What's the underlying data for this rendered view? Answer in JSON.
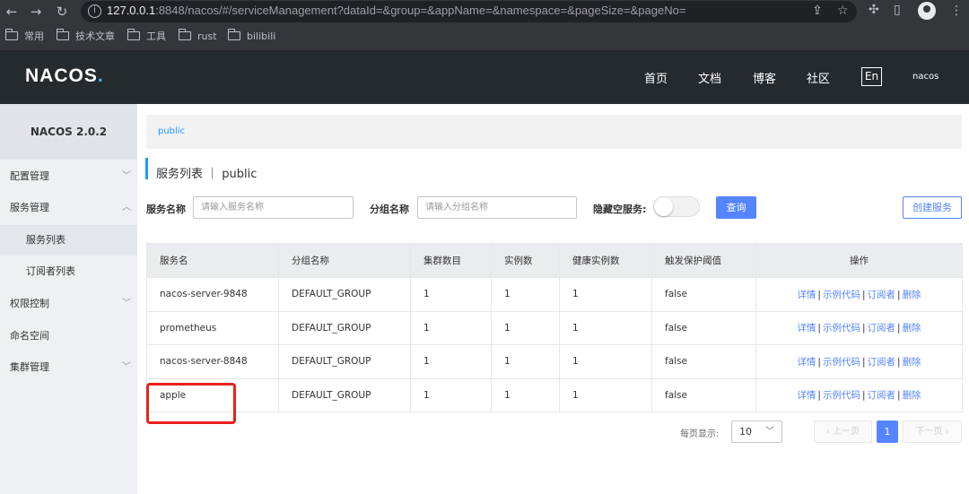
{
  "browser": {
    "url_host": "127.0.0.1",
    "url_rest": ":8848/nacos/#/serviceManagement?dataId=&group=&appName=&namespace=&pageSize=&pageNo=",
    "bookmarks": [
      "常用",
      "技术文章",
      "工具",
      "rust",
      "bilibili"
    ]
  },
  "header": {
    "logo_text": "NACOS",
    "logo_dot": ".",
    "nav": [
      "首页",
      "文档",
      "博客",
      "社区"
    ],
    "lang": "En",
    "user": "nacos"
  },
  "sidebar": {
    "title": "NACOS 2.0.2",
    "items": [
      {
        "label": "配置管理"
      },
      {
        "label": "服务管理"
      },
      {
        "label": "服务列表"
      },
      {
        "label": "订阅者列表"
      },
      {
        "label": "权限控制"
      },
      {
        "label": "命名空间"
      },
      {
        "label": "集群管理"
      }
    ]
  },
  "main": {
    "breadcrumb": "public",
    "title": "服务列表 ｜ public",
    "filters": {
      "service_label": "服务名称",
      "service_placeholder": "请输入服务名称",
      "group_label": "分组名称",
      "group_placeholder": "请输入分组名称",
      "hide_empty_label": "隐藏空服务:",
      "search_button": "查询",
      "create_button": "创建服务"
    },
    "table": {
      "columns": [
        "服务名",
        "分组名称",
        "集群数目",
        "实例数",
        "健康实例数",
        "触发保护阈值",
        "操作"
      ],
      "rows": [
        {
          "name": "nacos-server-9848",
          "group": "DEFAULT_GROUP",
          "clusters": "1",
          "instances": "1",
          "healthy": "1",
          "threshold": "false"
        },
        {
          "name": "prometheus",
          "group": "DEFAULT_GROUP",
          "clusters": "1",
          "instances": "1",
          "healthy": "1",
          "threshold": "false"
        },
        {
          "name": "nacos-server-8848",
          "group": "DEFAULT_GROUP",
          "clusters": "1",
          "instances": "1",
          "healthy": "1",
          "threshold": "false"
        },
        {
          "name": "apple",
          "group": "DEFAULT_GROUP",
          "clusters": "1",
          "instances": "1",
          "healthy": "1",
          "threshold": "false"
        }
      ],
      "actions": {
        "detail": "详情",
        "sample": "示例代码",
        "subscribers": "订阅者",
        "delete": "删除",
        "sep": "|"
      }
    },
    "pagination": {
      "page_size_label": "每页显示:",
      "page_size": "10",
      "prev": "上一页",
      "current": "1",
      "next": "下一页"
    }
  }
}
